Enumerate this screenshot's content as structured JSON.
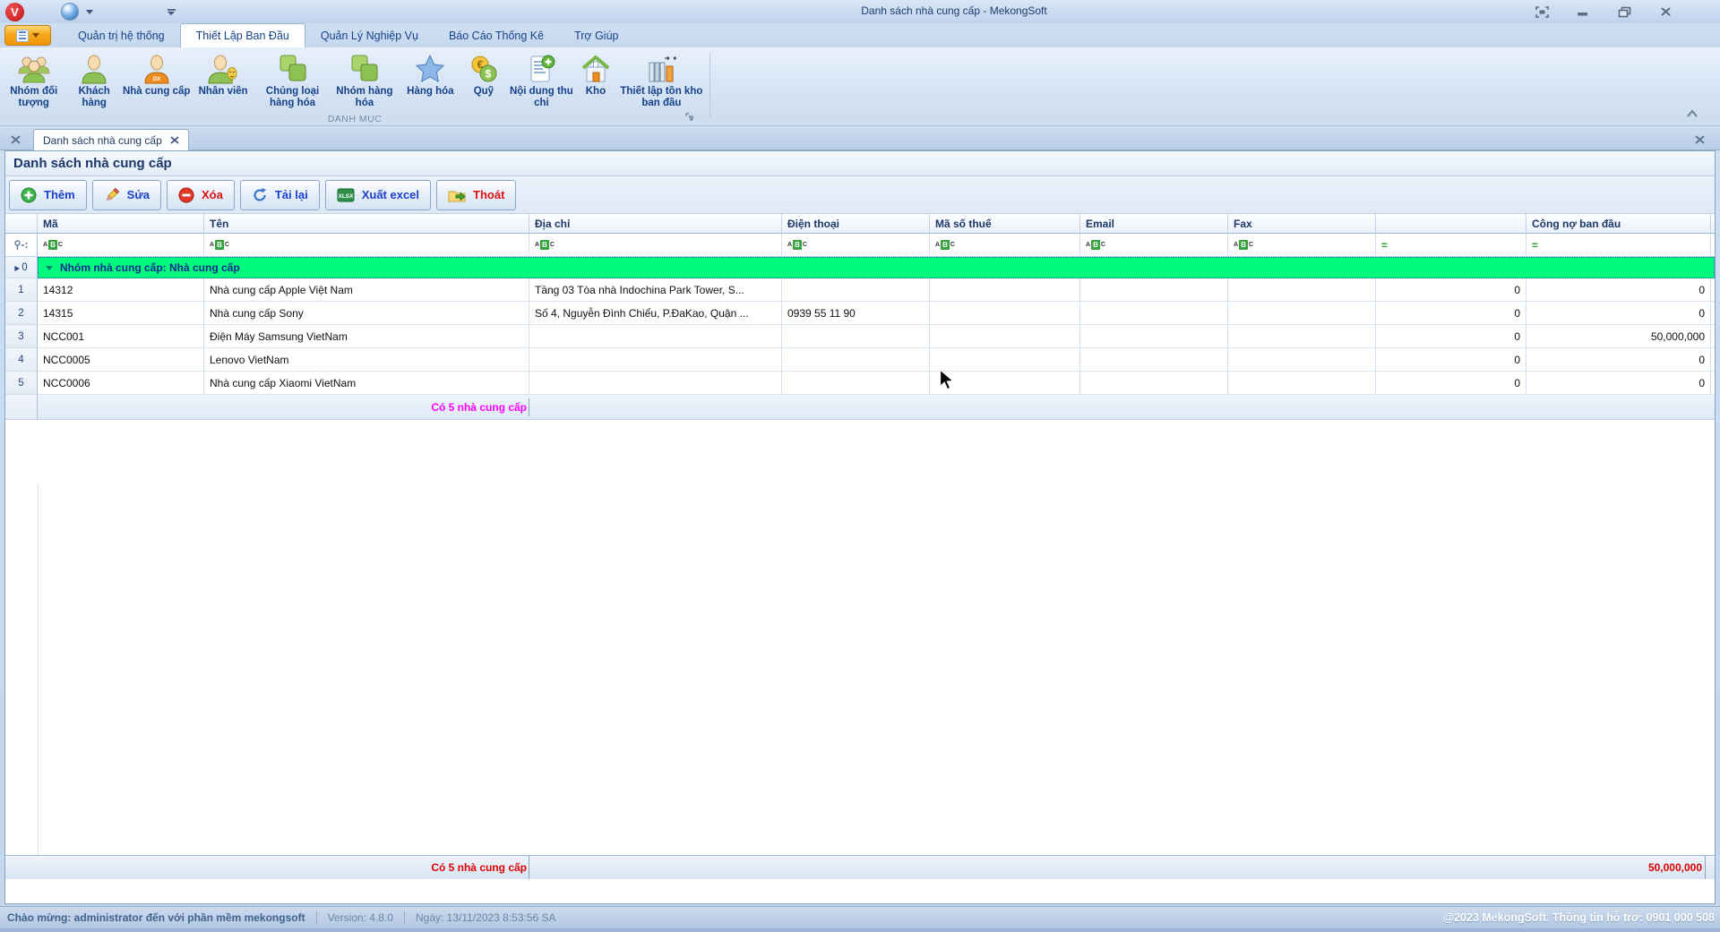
{
  "window": {
    "title": "Danh sách nhà cung cấp - MekongSoft",
    "logo_letter": "V"
  },
  "ribbon": {
    "tabs": [
      {
        "label": "Quản trị hệ thống"
      },
      {
        "label": "Thiết Lập Ban Đầu"
      },
      {
        "label": "Quản Lý Nghiệp Vụ"
      },
      {
        "label": "Báo Cáo Thống Kê"
      },
      {
        "label": "Trợ Giúp"
      }
    ],
    "group_label": "DANH MỤC",
    "items": [
      {
        "label": "Nhóm đối tượng"
      },
      {
        "label": "Khách hàng"
      },
      {
        "label": "Nhà cung cấp"
      },
      {
        "label": "Nhân viên"
      },
      {
        "label": "Chủng loại hàng hóa"
      },
      {
        "label": "Nhóm hàng hóa"
      },
      {
        "label": "Hàng hóa"
      },
      {
        "label": "Quỹ"
      },
      {
        "label": "Nội dung thu chi"
      },
      {
        "label": "Kho"
      },
      {
        "label": "Thiết lập tồn kho ban đầu"
      }
    ]
  },
  "icons": {
    "supplier_badge": "DX",
    "excel_badge": "XLSX",
    "euro": "€",
    "dollar": "$"
  },
  "doc_tab": {
    "label": "Danh sách nhà cung cấp"
  },
  "view": {
    "title": "Danh sách nhà cung cấp"
  },
  "toolbar": {
    "add": "Thêm",
    "edit": "Sửa",
    "delete": "Xóa",
    "reload": "Tải lại",
    "export": "Xuất excel",
    "exit": "Thoát"
  },
  "grid": {
    "columns": {
      "ma": "Mã",
      "ten": "Tên",
      "diachi": "Địa chỉ",
      "dienthoai": "Điện thoại",
      "masothue": "Mã số thuế",
      "email": "Email",
      "fax": "Fax",
      "congno0": "",
      "congno": "Công nợ ban đầu"
    },
    "filter": {
      "a": "A",
      "b": "B",
      "c": "C",
      "eq": "="
    },
    "group_row": {
      "index": "0",
      "arrow": "▸",
      "label": "Nhóm nhà cung cấp: Nhà cung cấp"
    },
    "rows": [
      {
        "n": "1",
        "ma": "14312",
        "ten": "Nhà cung cấp Apple Việt Nam",
        "diachi": "Tầng 03 Tòa nhà Indochina Park Tower, S...",
        "phone": "",
        "mst": "",
        "email": "",
        "fax": "",
        "no1": "0",
        "no2": "0"
      },
      {
        "n": "2",
        "ma": "14315",
        "ten": "Nhà cung cấp Sony",
        "diachi": "Số 4, Nguyễn Đình Chiểu, P.ĐaKao, Quận ...",
        "phone": "0939 55 11 90",
        "mst": "",
        "email": "",
        "fax": "",
        "no1": "0",
        "no2": "0"
      },
      {
        "n": "3",
        "ma": "NCC001",
        "ten": "Điện Máy Samsung VietNam",
        "diachi": "",
        "phone": "",
        "mst": "",
        "email": "",
        "fax": "",
        "no1": "0",
        "no2": "50,000,000"
      },
      {
        "n": "4",
        "ma": "NCC0005",
        "ten": "Lenovo VietNam",
        "diachi": "",
        "phone": "",
        "mst": "",
        "email": "",
        "fax": "",
        "no1": "0",
        "no2": "0"
      },
      {
        "n": "5",
        "ma": "NCC0006",
        "ten": "Nhà cung cấp Xiaomi VietNam",
        "diachi": "",
        "phone": "",
        "mst": "",
        "email": "",
        "fax": "",
        "no1": "0",
        "no2": "0"
      }
    ],
    "group_footer": {
      "count": "Có 5 nhà cung cấp"
    },
    "footer": {
      "count": "Có 5 nhà cung cấp",
      "total": "50,000,000"
    }
  },
  "statusbar": {
    "welcome": "Chào mừng: administrator đến với phần mềm mekongsoft",
    "version": "Version: 4.8.0",
    "date": "Ngày: 13/11/2023 8:53:56 SA",
    "copyright": "@2023 MekongSoft. Thông tin hỗ trợ: 0901 000 508"
  },
  "colors": {
    "group_row_green": "#00fa7e",
    "group_footer_magenta": "#ff00ff",
    "footer_red": "#dd0000",
    "accent_blue": "#15428b",
    "button_blue": "#1b3fd0",
    "button_red": "#e01111"
  }
}
